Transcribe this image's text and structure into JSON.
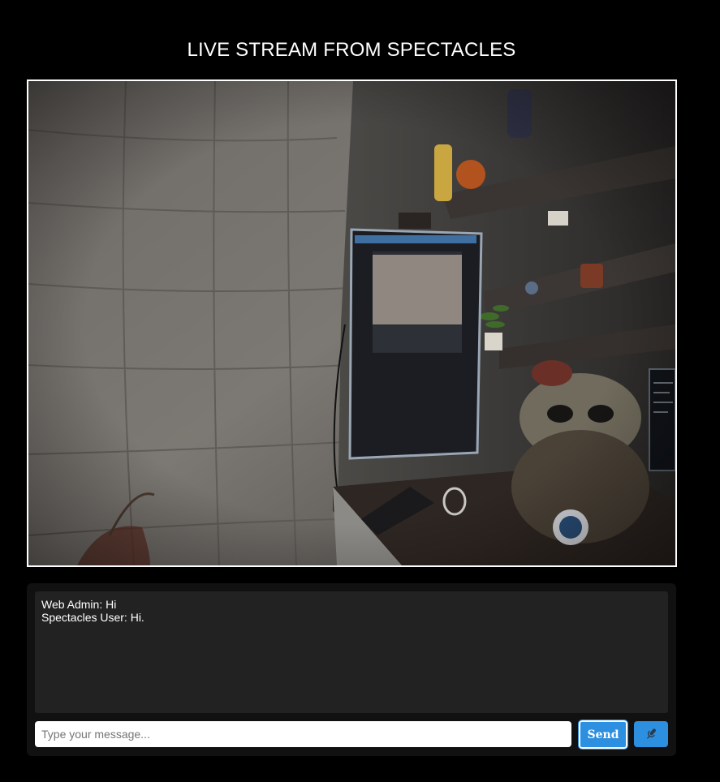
{
  "header": {
    "title": "LIVE STREAM FROM SPECTACLES"
  },
  "video": {
    "description_icon": "live-video-feed"
  },
  "chat": {
    "messages": [
      {
        "sender": "Web Admin",
        "text": "Hi",
        "line": "Web Admin: Hi"
      },
      {
        "sender": "Spectacles User",
        "text": "Hi.",
        "line": "Spectacles User: Hi."
      }
    ],
    "input_placeholder": "Type your message...",
    "input_value": "",
    "send_label": "Send",
    "mic_icon": "microphone-icon"
  },
  "colors": {
    "background": "#000000",
    "panel": "#111111",
    "chat_log": "#222222",
    "accent": "#2c8fe0"
  }
}
